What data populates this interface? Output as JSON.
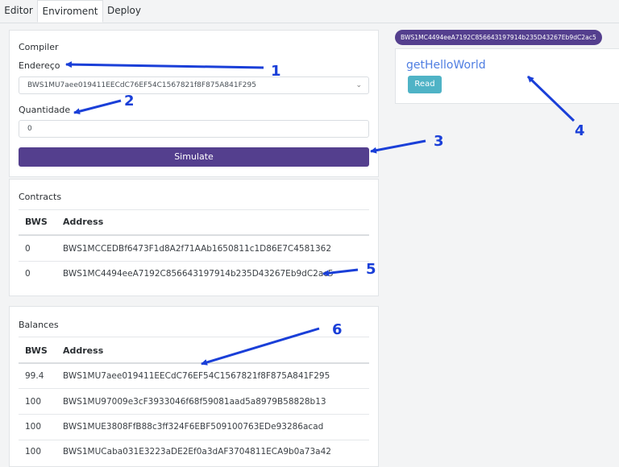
{
  "tabs": [
    {
      "label": "Editor"
    },
    {
      "label": "Enviroment"
    },
    {
      "label": "Deploy"
    }
  ],
  "compiler": {
    "title": "Compiler",
    "address_label": "Endereço",
    "address_value": "BWS1MU7aee019411EECdC76EF54C1567821f8F875A841F295",
    "quantity_label": "Quantidade",
    "quantity_placeholder": "0",
    "simulate_label": "Simulate"
  },
  "contracts": {
    "title": "Contracts",
    "headers": [
      "BWS",
      "Address"
    ],
    "rows": [
      {
        "bws": "0",
        "address": "BWS1MCCEDBf6473F1d8A2f71AAb1650811c1D86E7C4581362"
      },
      {
        "bws": "0",
        "address": "BWS1MC4494eeA7192C856643197914b235D43267Eb9dC2ac5"
      }
    ]
  },
  "balances": {
    "title": "Balances",
    "headers": [
      "BWS",
      "Address"
    ],
    "rows": [
      {
        "bws": "99.4",
        "address": "BWS1MU7aee019411EECdC76EF54C1567821f8F875A841F295"
      },
      {
        "bws": "100",
        "address": "BWS1MU97009e3cF3933046f68f59081aad5a8979B58828b13"
      },
      {
        "bws": "100",
        "address": "BWS1MUE3808FfB88c3ff324F6EBF509100763EDe93286acad"
      },
      {
        "bws": "100",
        "address": "BWS1MUCaba031E3223aDE2Ef0a3dAF3704811ECA9b0a73a42"
      }
    ]
  },
  "contract_panel": {
    "address_pill": "BWS1MC4494eeA7192C856643197914b235D43267Eb9dC2ac5",
    "function_name": "getHelloWorld",
    "read_label": "Read"
  },
  "annotations": [
    "1",
    "2",
    "3",
    "4",
    "5",
    "6"
  ],
  "colors": {
    "accent": "#543f8e",
    "read_button": "#4fb3c6",
    "function_link": "#4f7ee2",
    "annotation": "#1a3fd8"
  }
}
